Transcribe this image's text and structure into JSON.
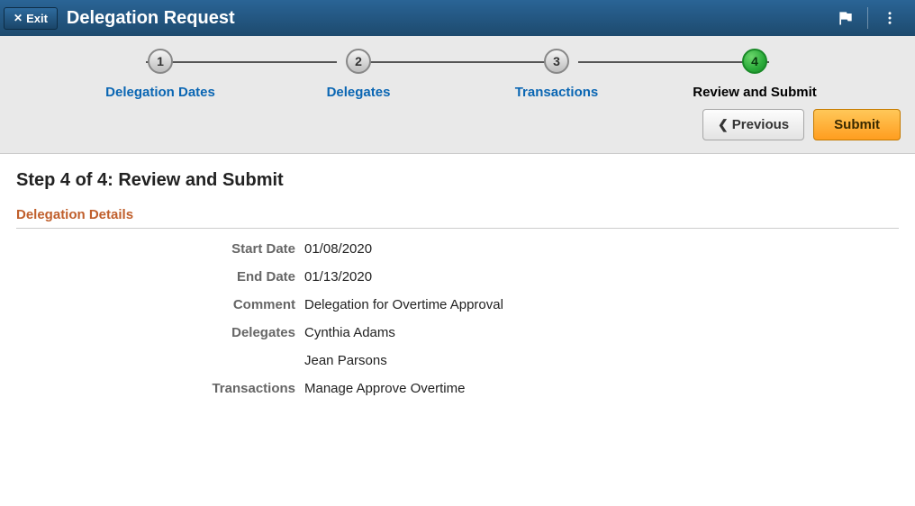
{
  "header": {
    "exit_label": "Exit",
    "page_title": "Delegation Request"
  },
  "stepper": {
    "steps": [
      {
        "num": "1",
        "label": "Delegation Dates",
        "active": false
      },
      {
        "num": "2",
        "label": "Delegates",
        "active": false
      },
      {
        "num": "3",
        "label": "Transactions",
        "active": false
      },
      {
        "num": "4",
        "label": "Review and Submit",
        "active": true
      }
    ]
  },
  "buttons": {
    "previous": "Previous",
    "submit": "Submit"
  },
  "content": {
    "step_heading": "Step 4 of 4: Review and Submit",
    "section_title": "Delegation Details",
    "fields": {
      "start_date_label": "Start Date",
      "start_date_value": "01/08/2020",
      "end_date_label": "End Date",
      "end_date_value": "01/13/2020",
      "comment_label": "Comment",
      "comment_value": "Delegation for Overtime Approval",
      "delegates_label": "Delegates",
      "delegates_values": [
        "Cynthia Adams",
        "Jean Parsons"
      ],
      "transactions_label": "Transactions",
      "transactions_values": [
        "Manage Approve Overtime"
      ]
    }
  }
}
